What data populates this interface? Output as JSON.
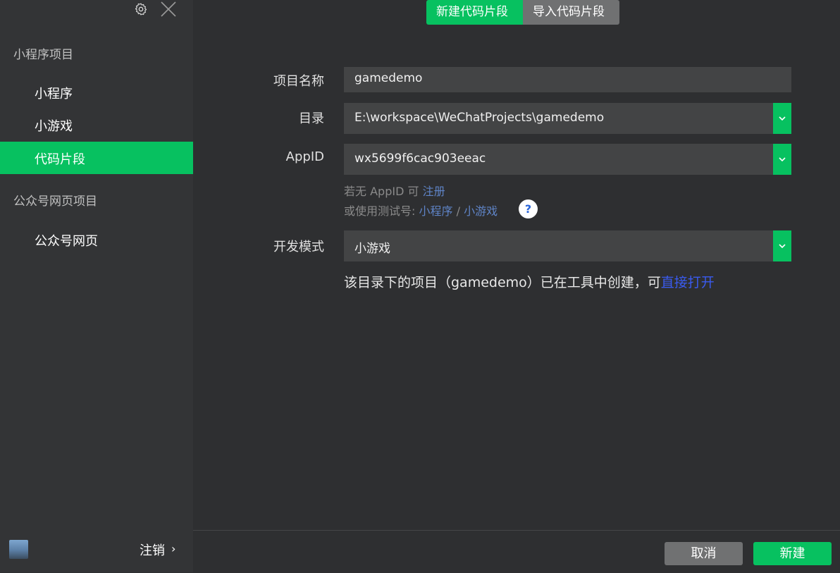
{
  "sidebar": {
    "mini_program_section": "小程序项目",
    "items": [
      {
        "label": "小程序"
      },
      {
        "label": "小游戏"
      },
      {
        "label": "代码片段"
      }
    ],
    "official_account_section": "公众号网页项目",
    "official_items": [
      {
        "label": "公众号网页"
      }
    ],
    "logout_label": "注销",
    "logout_arrow": "›",
    "icons": [
      "gear-icon",
      "close-icon",
      "avatar"
    ]
  },
  "tabs": [
    {
      "label": "新建代码片段",
      "active": true
    },
    {
      "label": "导入代码片段",
      "active": false
    }
  ],
  "form": {
    "name_label": "项目名称",
    "name_value": "gamedemo",
    "dir_label": "目录",
    "dir_value": "E:\\workspace\\WeChatProjects\\gamedemo",
    "appid_label": "AppID",
    "appid_value": "wx5699f6cac903eeac",
    "hint1_prefix": "若无 AppID 可 ",
    "hint1_link": "注册",
    "hint2_prefix": "或使用测试号: ",
    "hint2_link1": "小程序",
    "hint2_sep": " / ",
    "hint2_link2": "小游戏",
    "help_mark": "?",
    "mode_label": "开发模式",
    "mode_value": "小游戏",
    "notice_text": "该目录下的项目（gamedemo）已在工具中创建，可",
    "notice_link": "直接打开"
  },
  "buttons": {
    "cancel": "取消",
    "create": "新建"
  },
  "colors": {
    "accent": "#07c160",
    "link": "#5f84c7",
    "open_link": "#3a5bf0"
  }
}
